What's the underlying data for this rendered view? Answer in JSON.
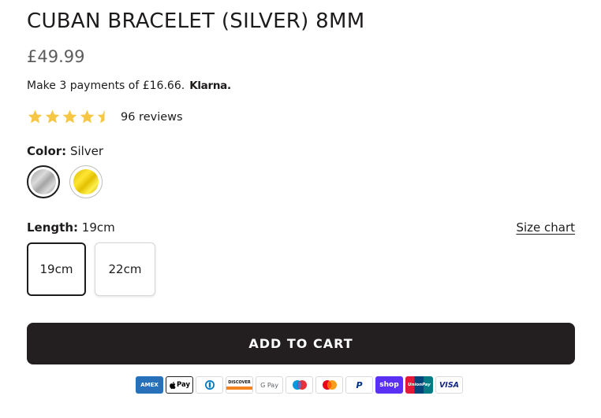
{
  "product": {
    "title": "CUBAN BRACELET (SILVER) 8MM",
    "price": "£49.99",
    "klarna_text": "Make 3 payments of £16.66.",
    "klarna_logo": "Klarna.",
    "rating_value": 4.5,
    "rating_max": 5,
    "reviews_text": "96 reviews"
  },
  "color": {
    "label": "Color:",
    "selected": "Silver",
    "swatches": [
      {
        "name": "Silver",
        "hex": "#c4c4c4",
        "selected": true
      },
      {
        "name": "Gold",
        "hex": "#f2d200",
        "selected": false
      }
    ]
  },
  "length": {
    "label": "Length:",
    "selected": "19cm",
    "size_chart": "Size chart",
    "options": [
      "19cm",
      "22cm"
    ]
  },
  "cart": {
    "button_label": "ADD TO CART"
  },
  "payments": {
    "amex": "AMEX",
    "applepay": "Pay",
    "discover": "DISCOVER",
    "googlepay": "G Pay",
    "paypal": "P",
    "shoppay": "shop",
    "unionpay": "UnionPay",
    "visa": "VISA"
  },
  "colors": {
    "star": "#f6c744",
    "button_bg": "#231f20",
    "text": "#1e1b1b"
  }
}
